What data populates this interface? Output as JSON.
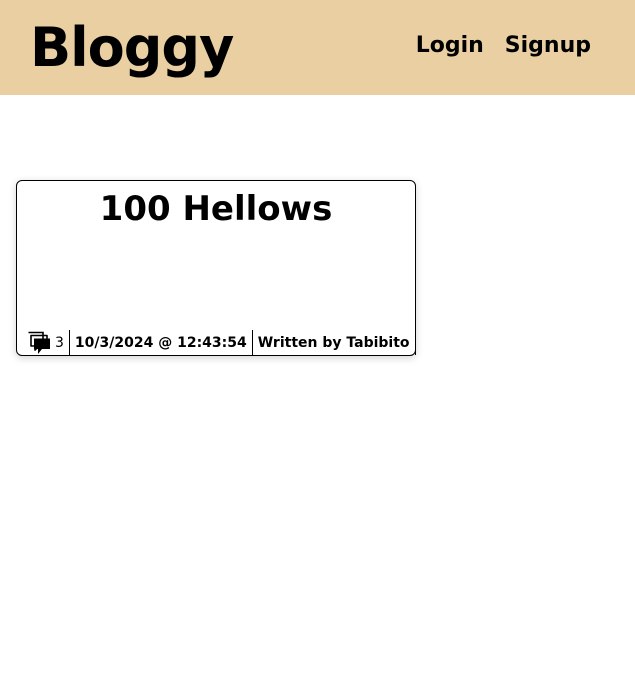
{
  "header": {
    "brand": "Bloggy",
    "nav": [
      {
        "label": "Login"
      },
      {
        "label": "Signup"
      }
    ],
    "background_color": "#e9cfa1"
  },
  "posts": [
    {
      "title": "100 Hellows",
      "comment_icon": "comments-icon",
      "comment_count": "3",
      "timestamp": "10/3/2024 @ 12:43:54",
      "author_line": "Written by Tabibito"
    }
  ]
}
